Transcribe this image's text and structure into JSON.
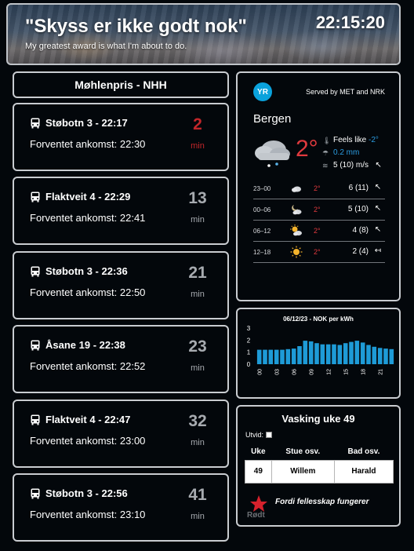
{
  "header": {
    "title": "\"Skyss er ikke godt nok\"",
    "subtitle": "My greatest award is what I'm about to do.",
    "clock": "22:15:20"
  },
  "stop": {
    "name": "Møhlenpris - NHH"
  },
  "departures": [
    {
      "line": "Støbotn 3 - 22:17",
      "eta": "Forventet ankomst: 22:30",
      "minutes": "2",
      "unit": "min",
      "urgent": true
    },
    {
      "line": "Flaktveit 4 - 22:29",
      "eta": "Forventet ankomst: 22:41",
      "minutes": "13",
      "unit": "min"
    },
    {
      "line": "Støbotn 3 - 22:36",
      "eta": "Forventet ankomst: 22:50",
      "minutes": "21",
      "unit": "min"
    },
    {
      "line": "Åsane 19 - 22:38",
      "eta": "Forventet ankomst: 22:52",
      "minutes": "23",
      "unit": "min"
    },
    {
      "line": "Flaktveit 4 - 22:47",
      "eta": "Forventet ankomst: 23:00",
      "minutes": "32",
      "unit": "min"
    },
    {
      "line": "Støbotn 3 - 22:56",
      "eta": "Forventet ankomst: 23:10",
      "minutes": "41",
      "unit": "min"
    }
  ],
  "weather": {
    "logo_text": "YR",
    "served_by": "Served by MET and NRK",
    "city": "Bergen",
    "current_temp": "2°",
    "feels_like_label": "Feels like",
    "feels_like_value": "-2°",
    "precip": "0.2 mm",
    "wind": "5 (10) m/s",
    "icons": {
      "current": "cloud-snow-icon"
    },
    "forecast": [
      {
        "period": "23–00",
        "icon": "cloud-icon",
        "temp": "2°",
        "wind": "6 (11)",
        "arrow": "↖"
      },
      {
        "period": "00–06",
        "icon": "partly-cloudy-night-icon",
        "temp": "2°",
        "wind": "5 (10)",
        "arrow": "↖"
      },
      {
        "period": "06–12",
        "icon": "partly-sunny-icon",
        "temp": "2°",
        "wind": "4 (8)",
        "arrow": "↖"
      },
      {
        "period": "12–18",
        "icon": "sun-icon",
        "temp": "2°",
        "wind": "2 (4)",
        "arrow": "↤"
      }
    ]
  },
  "chart_data": {
    "type": "bar",
    "title": "06/12/23 - NOK per kWh",
    "ylim": [
      0,
      3
    ],
    "yticks": [
      "0",
      "1",
      "2",
      "3"
    ],
    "xticks": [
      "00",
      "03",
      "06",
      "09",
      "12",
      "15",
      "18",
      "21"
    ],
    "values": [
      1.2,
      1.2,
      1.2,
      1.2,
      1.2,
      1.25,
      1.3,
      1.5,
      1.95,
      1.9,
      1.75,
      1.65,
      1.65,
      1.65,
      1.6,
      1.75,
      1.85,
      1.95,
      1.8,
      1.6,
      1.45,
      1.35,
      1.3,
      1.25
    ],
    "color": "#1e9bd7"
  },
  "laundry": {
    "title": "Vasking uke 49",
    "expand_label": "Utvid:",
    "headers": [
      "Uke",
      "Stue osv.",
      "Bad osv."
    ],
    "rows": [
      [
        "49",
        "Willem",
        "Harald"
      ]
    ],
    "slogan": "Fordi fellesskap fungerer",
    "logo_text": "Rødt"
  }
}
